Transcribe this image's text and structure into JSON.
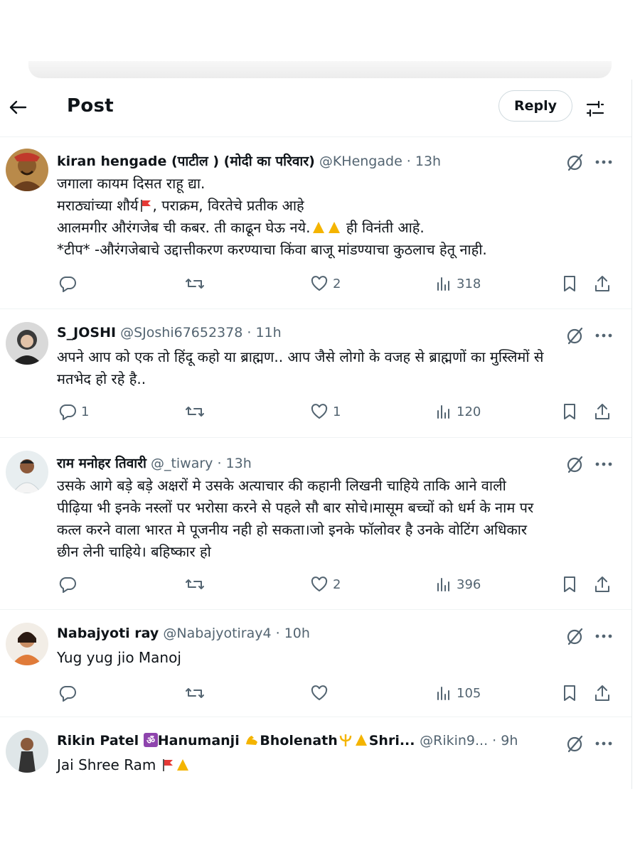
{
  "header": {
    "title": "Post",
    "reply_label": "Reply"
  },
  "replies": [
    {
      "name": "kiran hengade (पाटील ) (मोदी का परिवार)",
      "handle": "@KHengade · 13h",
      "lines": [
        "जगाला कायम दिसत राहू द्या.",
        "मराठ्यांच्या शौर्य",
        ", पराक्रम, विरतेचे प्रतीक आहे",
        "आलमगीर औरंगजेब ची कबर. ती काढून घेऊ नये.",
        " ही विनंती आहे.",
        " *टीप* -औरंगजेबाचे उद्दात्तीकरण करण्याचा किंवा बाजू मांडण्याचा कुठलाच हेतू नाही."
      ],
      "replies_count": "",
      "likes": "2",
      "views": "318"
    },
    {
      "name": "S_JOSHI",
      "handle": "@SJoshi67652378 · 11h",
      "lines": [
        "अपने आप को एक तो हिंदू कहो या ब्राह्मण.. आप जैसे  लोगो के वजह से ब्राह्मणों का मुस्लिमों से",
        "मतभेद हो रहे है.."
      ],
      "replies_count": "1",
      "likes": "1",
      "views": "120"
    },
    {
      "name": "राम मनोहर तिवारी",
      "handle": "@_tiwary · 13h",
      "lines": [
        "उसके आगे बड़े बड़े अक्षरों मे उसके अत्याचार की कहानी लिखनी चाहिये ताकि आने वाली",
        "पीढ़िया भी इनके नस्लों पर भरोसा करने से पहले सौ बार सोचे।मासूम बच्चों को धर्म के नाम पर",
        "कत्ल करने वाला भारत मे पूजनीय नही हो सकता।जो इनके फॉलोवर है उनके वोटिंग अधिकार",
        "छीन लेनी चाहिये। बहिष्कार हो"
      ],
      "replies_count": "",
      "likes": "2",
      "views": "396"
    },
    {
      "name": "Nabajyoti ray",
      "handle": "@Nabajyotiray4 · 10h",
      "lines": [
        "Yug yug jio Manoj"
      ],
      "replies_count": "",
      "likes": "",
      "views": "105"
    },
    {
      "name_parts": [
        "Rikin Patel ",
        "Hanumanji ",
        "Bholenath",
        "Shri..."
      ],
      "handle": "@Rikin9... · 9h",
      "lines": [
        "Jai Shree Ram "
      ]
    }
  ],
  "icons": {
    "back": "arrow-left-icon",
    "filter": "sliders-icon",
    "grok": "grok-icon",
    "more": "more-icon",
    "reply": "reply-icon",
    "repost": "repost-icon",
    "like": "heart-icon",
    "views": "views-icon",
    "bookmark": "bookmark-icon",
    "share": "share-icon",
    "flag": "red-flag-emoji",
    "hands": "folded-hands-emoji",
    "om": "om-emoji",
    "muscle": "flexed-biceps-emoji",
    "trident": "trident-emoji"
  },
  "colors": {
    "text": "#0f1419",
    "muted": "#536471",
    "divider": "#eff3f4",
    "border": "#cfd9de"
  }
}
